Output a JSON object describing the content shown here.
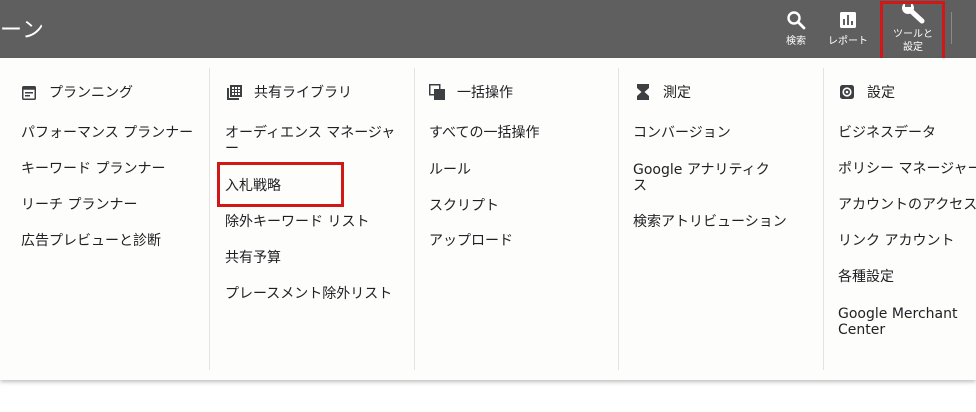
{
  "topbar": {
    "title": "ーン",
    "search_label": "検索",
    "report_label": "レポート",
    "tools_label_line1": "ツールと",
    "tools_label_line2": "設定"
  },
  "menu": {
    "planning": {
      "header": "プランニング",
      "items": [
        "パフォーマンス プランナー",
        "キーワード プランナー",
        "リーチ プランナー",
        "広告プレビューと診断"
      ]
    },
    "shared_library": {
      "header": "共有ライブラリ",
      "items": [
        "オーディエンス マネージャ",
        "ー",
        "入札戦略",
        "除外キーワード リスト",
        "共有予算",
        "プレースメント除外リスト"
      ]
    },
    "bulk_actions": {
      "header": "一括操作",
      "items": [
        "すべての一括操作",
        "ルール",
        "スクリプト",
        "アップロード"
      ]
    },
    "measurement": {
      "header": "測定",
      "items": [
        "コンバージョン",
        "Google アナリティク",
        "ス",
        "検索アトリビューション"
      ]
    },
    "settings": {
      "header": "設定",
      "items": [
        "ビジネスデータ",
        "ポリシー マネージャー",
        "アカウントのアクセス",
        "リンク アカウント",
        "各種設定",
        "Google Merchant",
        "Center"
      ]
    }
  },
  "colors": {
    "topbar": "#5f5f5f",
    "highlight": "#d11818",
    "text": "#202124"
  },
  "icons": [
    "search-icon",
    "report-icon",
    "wrench-icon",
    "calendar-icon",
    "library-icon",
    "copy-icon",
    "hourglass-icon",
    "settings-gear-icon"
  ]
}
